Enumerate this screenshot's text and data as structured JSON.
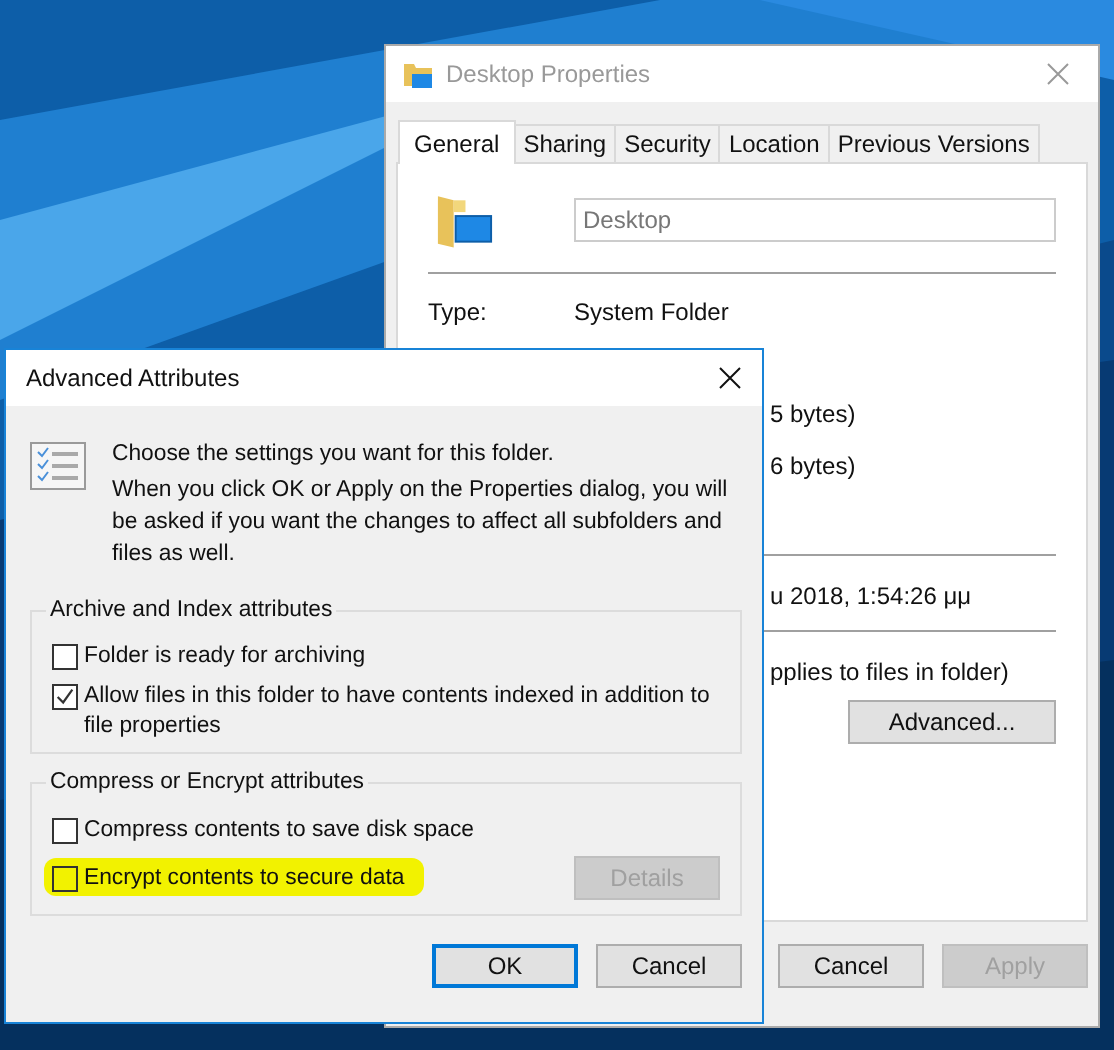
{
  "properties_window": {
    "title": "Desktop Properties",
    "tabs": [
      {
        "label": "General",
        "selected": true
      },
      {
        "label": "Sharing",
        "selected": false
      },
      {
        "label": "Security",
        "selected": false
      },
      {
        "label": "Location",
        "selected": false
      },
      {
        "label": "Previous Versions",
        "selected": false
      }
    ],
    "name_field": {
      "value": "Desktop"
    },
    "type_label": "Type:",
    "type_value": "System Folder",
    "partial_texts": [
      "5 bytes)",
      "6 bytes)",
      "u 2018, 1:54:26 μμ",
      "pplies to files in folder)"
    ],
    "advanced_button": "Advanced...",
    "buttons": [
      {
        "label": "Cancel",
        "disabled": false
      },
      {
        "label": "Apply",
        "disabled": true
      }
    ]
  },
  "dialog": {
    "title": "Advanced Attributes",
    "intro": "Choose the settings you want for this folder.",
    "note": "When you click OK or Apply on the Properties dialog, you will be asked if you want the changes to affect all subfolders and files as well.",
    "groups": [
      {
        "title": "Archive and Index attributes",
        "options": [
          {
            "label": "Folder is ready for archiving",
            "checked": false,
            "highlighted": false
          },
          {
            "label": "Allow files in this folder to have contents indexed in addition to file properties",
            "checked": true,
            "highlighted": false
          }
        ]
      },
      {
        "title": "Compress or Encrypt attributes",
        "options": [
          {
            "label": "Compress contents to save disk space",
            "checked": false,
            "highlighted": false
          },
          {
            "label": "Encrypt contents to secure data",
            "checked": false,
            "highlighted": true
          }
        ],
        "button": {
          "label": "Details",
          "disabled": true
        }
      }
    ],
    "buttons": [
      {
        "label": "OK",
        "default": true
      },
      {
        "label": "Cancel",
        "default": false
      }
    ]
  }
}
